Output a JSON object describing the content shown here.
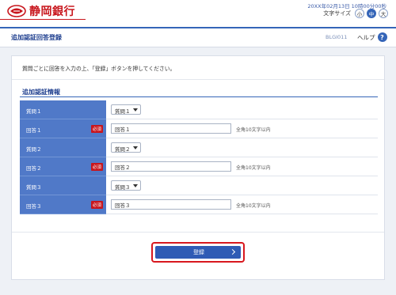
{
  "header": {
    "bank_name": "静岡銀行",
    "datetime": "20XX年02月13日 10時00分00秒",
    "font_size_label": "文字サイズ",
    "font_sizes": [
      "小",
      "中",
      "大"
    ],
    "active_font_size": "中"
  },
  "nav": {
    "page_title": "追加認証回答登録",
    "screen_id": "BLGI011",
    "help_label": "ヘルプ",
    "help_icon": "?"
  },
  "main": {
    "instruction": "質問ごとに回答を入力の上、「登録」ボタンを押してください。",
    "section_title": "追加認証情報",
    "required_badge": "必須",
    "rows": [
      {
        "type": "select",
        "label": "質問１",
        "value": "質問１"
      },
      {
        "type": "input",
        "label": "回答１",
        "value": "回答１",
        "hint": "全角10文字以内"
      },
      {
        "type": "select",
        "label": "質問２",
        "value": "質問２"
      },
      {
        "type": "input",
        "label": "回答２",
        "value": "回答２",
        "hint": "全角10文字以内"
      },
      {
        "type": "select",
        "label": "質問３",
        "value": "質問３"
      },
      {
        "type": "input",
        "label": "回答３",
        "value": "回答３",
        "hint": "全角10文字以内"
      }
    ],
    "submit_label": "登録"
  },
  "colors": {
    "brand_red": "#c8161d",
    "primary_blue": "#3565b8",
    "label_blue": "#5079c8",
    "highlight_red": "#d8171e"
  }
}
